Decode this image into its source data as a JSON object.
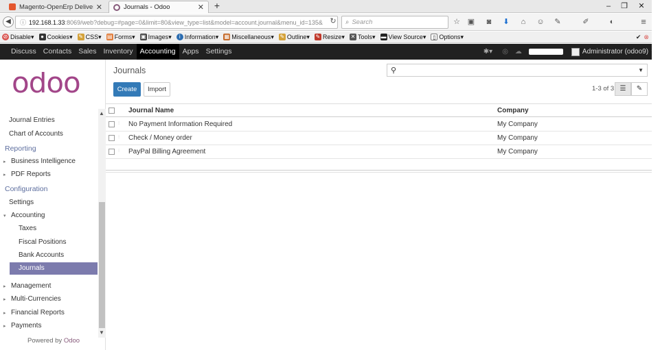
{
  "browser": {
    "tabs": [
      {
        "label": "Magento-OpenErp Deliver...",
        "active": false
      },
      {
        "label": "Journals - Odoo",
        "active": true
      }
    ],
    "new_tab": "+",
    "window_controls": [
      "–",
      "❐",
      "✕"
    ],
    "url_host": "192.168.1.33",
    "url_path": ":8069/web?debug=#page=0&limit=80&view_type=list&model=account.journal&menu_id=135&",
    "search_placeholder": "Search"
  },
  "dev_toolbar": {
    "items": [
      "Disable",
      "Cookies",
      "CSS",
      "Forms",
      "Images",
      "Information",
      "Miscellaneous",
      "Outline",
      "Resize",
      "Tools",
      "View Source",
      "Options"
    ]
  },
  "top_menu": {
    "items": [
      "Discuss",
      "Contacts",
      "Sales",
      "Inventory",
      "Accounting",
      "Apps",
      "Settings"
    ],
    "active": "Accounting",
    "user": "Administrator (odoo9)"
  },
  "sidebar": {
    "logo": "odoo",
    "items_top": [
      "Journal Entries",
      "Chart of Accounts"
    ],
    "reporting_head": "Reporting",
    "reporting_items": [
      "Business Intelligence",
      "PDF Reports"
    ],
    "config_head": "Configuration",
    "config_settings": "Settings",
    "accounting_group": "Accounting",
    "accounting_sub": [
      "Taxes",
      "Fiscal Positions",
      "Bank Accounts",
      "Journals"
    ],
    "active_sub": "Journals",
    "more_items": [
      "Management",
      "Multi-Currencies",
      "Financial Reports",
      "Payments"
    ],
    "powered_by": "Powered by",
    "powered_brand": "Odoo"
  },
  "control_panel": {
    "title": "Journals",
    "create_label": "Create",
    "import_label": "Import",
    "pager": "1-3 of 3"
  },
  "list": {
    "columns": [
      "Journal Name",
      "Company"
    ],
    "rows": [
      {
        "name": "No Payment Information Required",
        "company": "My Company"
      },
      {
        "name": "Check / Money order",
        "company": "My Company"
      },
      {
        "name": "PayPal Billing Agreement",
        "company": "My Company"
      }
    ]
  },
  "colors": {
    "brand_purple": "#875a7b",
    "menu_active": "#7c7bad",
    "primary_button": "#337ab7"
  }
}
